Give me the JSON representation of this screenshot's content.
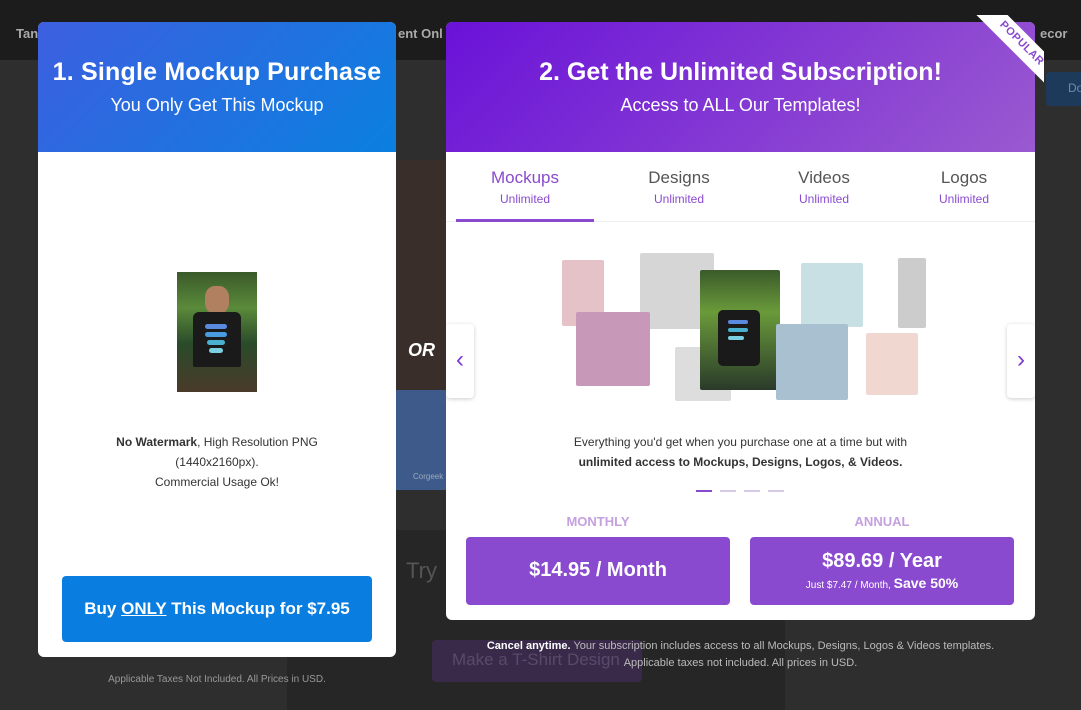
{
  "background": {
    "nav_left": "Tan",
    "nav_mid": "ent Onl",
    "nav_right": "ecor",
    "right_btn": "Do",
    "corgeek": "Corgeek",
    "try_text": "Try",
    "make_btn": "Make a T-Shirt Design"
  },
  "single": {
    "title": "1. Single Mockup Purchase",
    "subtitle": "You Only Get This Mockup",
    "desc_bold": "No Watermark",
    "desc_rest": ", High Resolution PNG",
    "desc_line2": "(1440x2160px).",
    "desc_line3": "Commercial Usage Ok!",
    "buy_pre": "Buy ",
    "buy_only": "ONLY",
    "buy_post": " This Mockup for $7.95",
    "footer": "Applicable Taxes Not Included. All Prices in USD."
  },
  "or_label": "OR",
  "unlimited": {
    "ribbon": "POPULAR",
    "title": "2. Get the Unlimited Subscription!",
    "subtitle": "Access to ALL Our Templates!",
    "tabs": [
      {
        "label": "Mockups",
        "sub": "Unlimited"
      },
      {
        "label": "Designs",
        "sub": "Unlimited"
      },
      {
        "label": "Videos",
        "sub": "Unlimited"
      },
      {
        "label": "Logos",
        "sub": "Unlimited"
      }
    ],
    "desc_line1": "Everything you'd get when you purchase one at a time but with",
    "desc_line2": "unlimited access to Mockups, Designs, Logos, & Videos.",
    "monthly_label": "MONTHLY",
    "monthly_price": "$14.95 / Month",
    "annual_label": "ANNUAL",
    "annual_price": "$89.69 / Year",
    "annual_sub": "Just $7.47 / Month, ",
    "annual_save": "Save 50%",
    "footer_bold": "Cancel anytime.",
    "footer_rest": " Your subscription includes access to all Mockups, Designs, Logos & Videos templates.",
    "footer_line2": "Applicable taxes not included. All prices in USD."
  },
  "colors": {
    "accent_purple": "#8a4ad0",
    "accent_blue": "#0a7ee0"
  }
}
